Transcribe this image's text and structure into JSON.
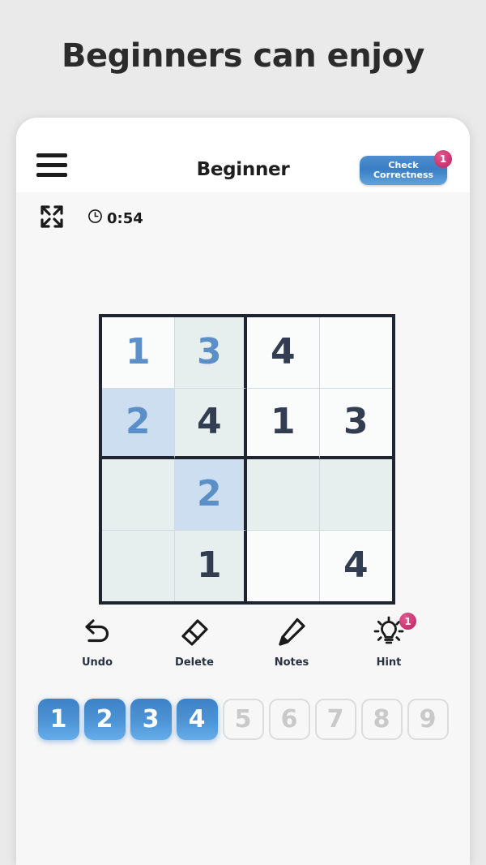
{
  "promo": {
    "headline": "Beginners can enjoy"
  },
  "appbar": {
    "menu_icon": "hamburger-menu-icon",
    "title": "Beginner",
    "check_button": {
      "line1": "Check",
      "line2": "Correctness",
      "badge": "1"
    }
  },
  "status": {
    "expand_icon": "fullscreen-expand-icon",
    "clock_icon": "clock-icon",
    "time": "0:54"
  },
  "board": {
    "size": 4,
    "cells": [
      [
        {
          "value": "1",
          "style": "user",
          "bg": "none"
        },
        {
          "value": "3",
          "style": "user",
          "bg": "soft"
        },
        {
          "value": "4",
          "style": "given",
          "bg": "none"
        },
        {
          "value": "",
          "style": "given",
          "bg": "none"
        }
      ],
      [
        {
          "value": "2",
          "style": "user",
          "bg": "strong"
        },
        {
          "value": "4",
          "style": "given",
          "bg": "soft"
        },
        {
          "value": "1",
          "style": "given",
          "bg": "none"
        },
        {
          "value": "3",
          "style": "given",
          "bg": "none"
        }
      ],
      [
        {
          "value": "",
          "style": "given",
          "bg": "soft"
        },
        {
          "value": "2",
          "style": "user",
          "bg": "strong"
        },
        {
          "value": "",
          "style": "given",
          "bg": "soft"
        },
        {
          "value": "",
          "style": "given",
          "bg": "soft"
        }
      ],
      [
        {
          "value": "",
          "style": "given",
          "bg": "soft"
        },
        {
          "value": "1",
          "style": "given",
          "bg": "soft"
        },
        {
          "value": "",
          "style": "given",
          "bg": "none"
        },
        {
          "value": "4",
          "style": "given",
          "bg": "none"
        }
      ]
    ]
  },
  "tools": [
    {
      "label": "Undo",
      "icon": "undo-arrow-icon",
      "badge": ""
    },
    {
      "label": "Delete",
      "icon": "eraser-icon",
      "badge": ""
    },
    {
      "label": "Notes",
      "icon": "pencil-icon",
      "badge": ""
    },
    {
      "label": "Hint",
      "icon": "lightbulb-icon",
      "badge": "1"
    }
  ],
  "numpad": [
    {
      "label": "1",
      "state": "active"
    },
    {
      "label": "2",
      "state": "active"
    },
    {
      "label": "3",
      "state": "active"
    },
    {
      "label": "4",
      "state": "active"
    },
    {
      "label": "5",
      "state": "disabled"
    },
    {
      "label": "6",
      "state": "disabled"
    },
    {
      "label": "7",
      "state": "disabled"
    },
    {
      "label": "8",
      "state": "disabled"
    },
    {
      "label": "9",
      "state": "disabled"
    }
  ],
  "colors": {
    "page_bg": "#eaeaea",
    "app_bg": "#f7f7f7",
    "accent_blue": "#4d94d6",
    "user_digit": "#5b8fc7",
    "given_digit": "#333d52",
    "badge_pink": "#c9316f",
    "grid_line": "#1e2530",
    "highlight_soft": "#e6eeee",
    "highlight_strong": "#ccdeef"
  }
}
